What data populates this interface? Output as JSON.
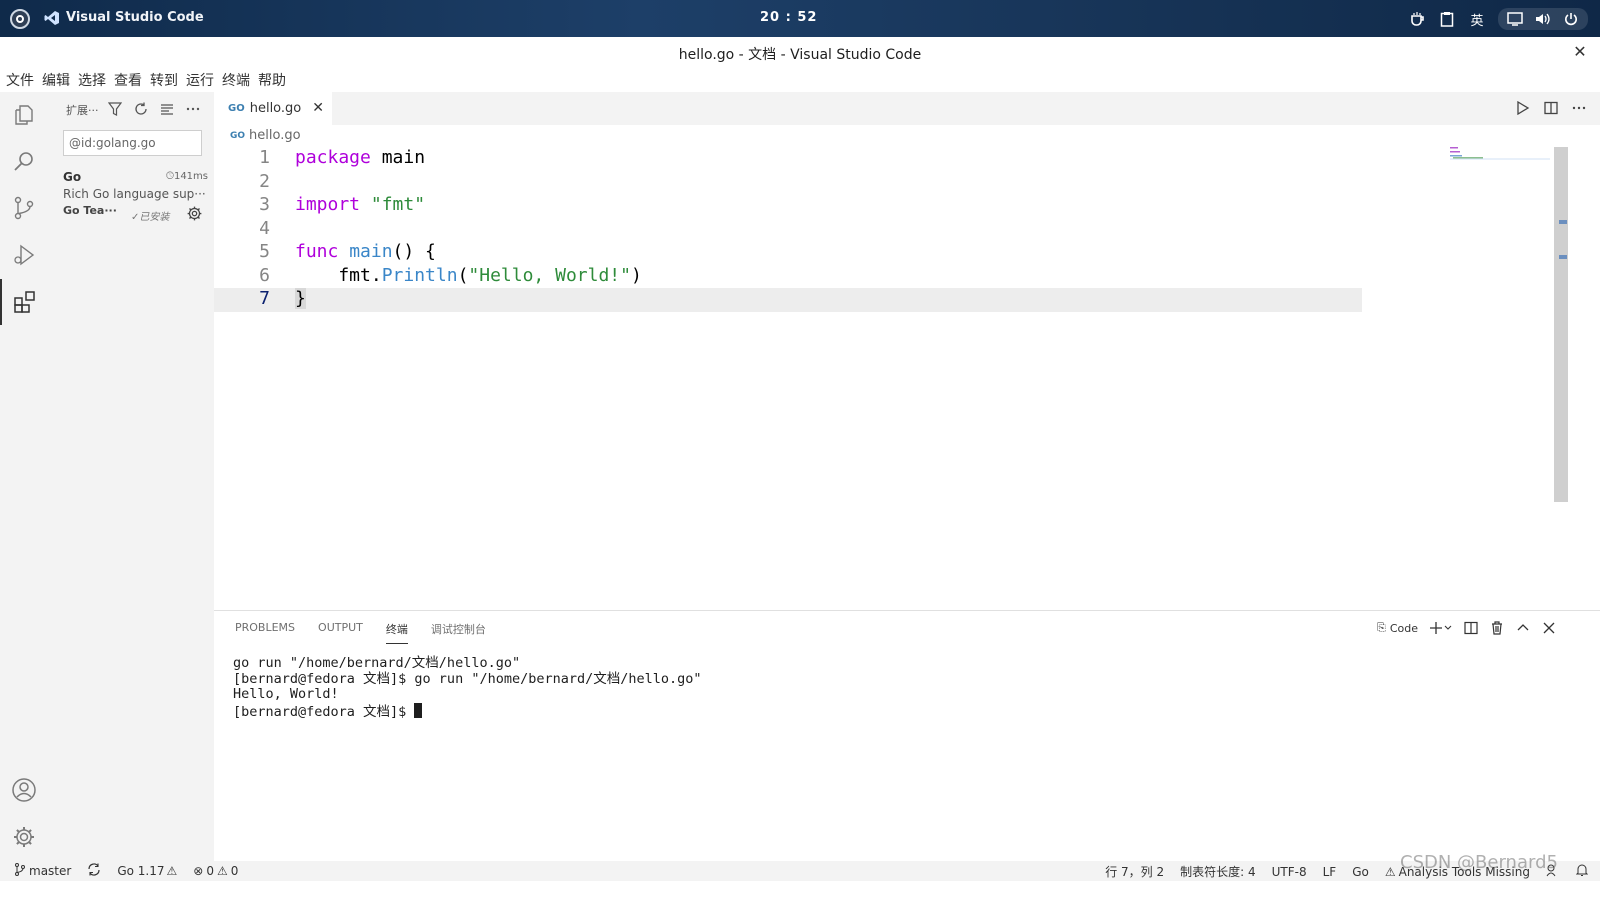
{
  "system": {
    "app_name": "Visual Studio Code",
    "clock": "20 : 52",
    "input_method": "英"
  },
  "window": {
    "title": "hello.go - 文档 - Visual Studio Code"
  },
  "menu": [
    "文件",
    "编辑",
    "选择",
    "查看",
    "转到",
    "运行",
    "终端",
    "帮助"
  ],
  "sidebar": {
    "header": "扩展···",
    "search_value": "@id:golang.go",
    "extension": {
      "name": "Go",
      "time": "141ms",
      "description": "Rich Go language sup···",
      "publisher": "Go Tea···",
      "status": "✓已安装"
    }
  },
  "editor": {
    "tab_label": "hello.go",
    "tab_icon": "GO",
    "breadcrumb": "hello.go",
    "line_numbers": [
      "1",
      "2",
      "3",
      "4",
      "5",
      "6",
      "7"
    ],
    "code": {
      "l1_kw": "package",
      "l1_rest": " main",
      "l3_kw": "import",
      "l3_str": " \"fmt\"",
      "l5_kw": "func",
      "l5_fn": " main",
      "l5_rest": "() {",
      "l6_indent": "    fmt.",
      "l6_fn": "Println",
      "l6_open": "(",
      "l6_str": "\"Hello, World!\"",
      "l6_close": ")",
      "l7": "}"
    }
  },
  "panel": {
    "tabs": [
      "PROBLEMS",
      "OUTPUT",
      "终端",
      "调试控制台"
    ],
    "terminal_label": "Code",
    "terminal_lines": [
      "go run \"/home/bernard/文档/hello.go\"",
      "[bernard@fedora 文档]$ go run \"/home/bernard/文档/hello.go\"",
      "Hello, World!",
      "[bernard@fedora 文档]$ "
    ]
  },
  "status": {
    "branch": "master",
    "go_version": "Go 1.17",
    "errors": "0",
    "warnings": "0",
    "position": "行 7，列 2",
    "tab_size": "制表符长度: 4",
    "encoding": "UTF-8",
    "eol": "LF",
    "language": "Go",
    "analysis": "Analysis Tools Missing"
  },
  "watermark": "CSDN @Bernard5"
}
